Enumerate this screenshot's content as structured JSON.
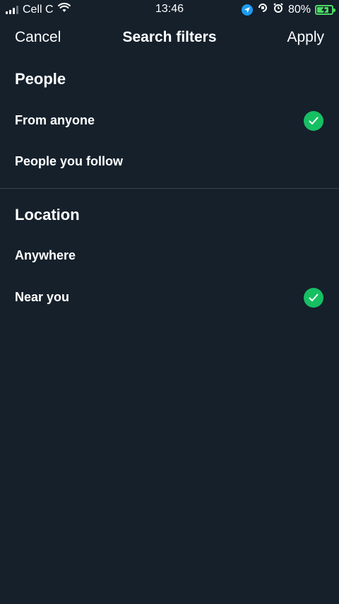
{
  "status_bar": {
    "carrier": "Cell C",
    "time": "13:46",
    "battery_percent": "80%",
    "battery_level": 0.8
  },
  "nav": {
    "cancel_label": "Cancel",
    "title": "Search filters",
    "apply_label": "Apply"
  },
  "sections": {
    "people": {
      "title": "People",
      "options": [
        {
          "label": "From anyone",
          "selected": true
        },
        {
          "label": "People you follow",
          "selected": false
        }
      ]
    },
    "location": {
      "title": "Location",
      "options": [
        {
          "label": "Anywhere",
          "selected": false
        },
        {
          "label": "Near you",
          "selected": true
        }
      ]
    }
  },
  "colors": {
    "background": "#15202b",
    "check": "#17bf63",
    "divider": "#38444d"
  }
}
